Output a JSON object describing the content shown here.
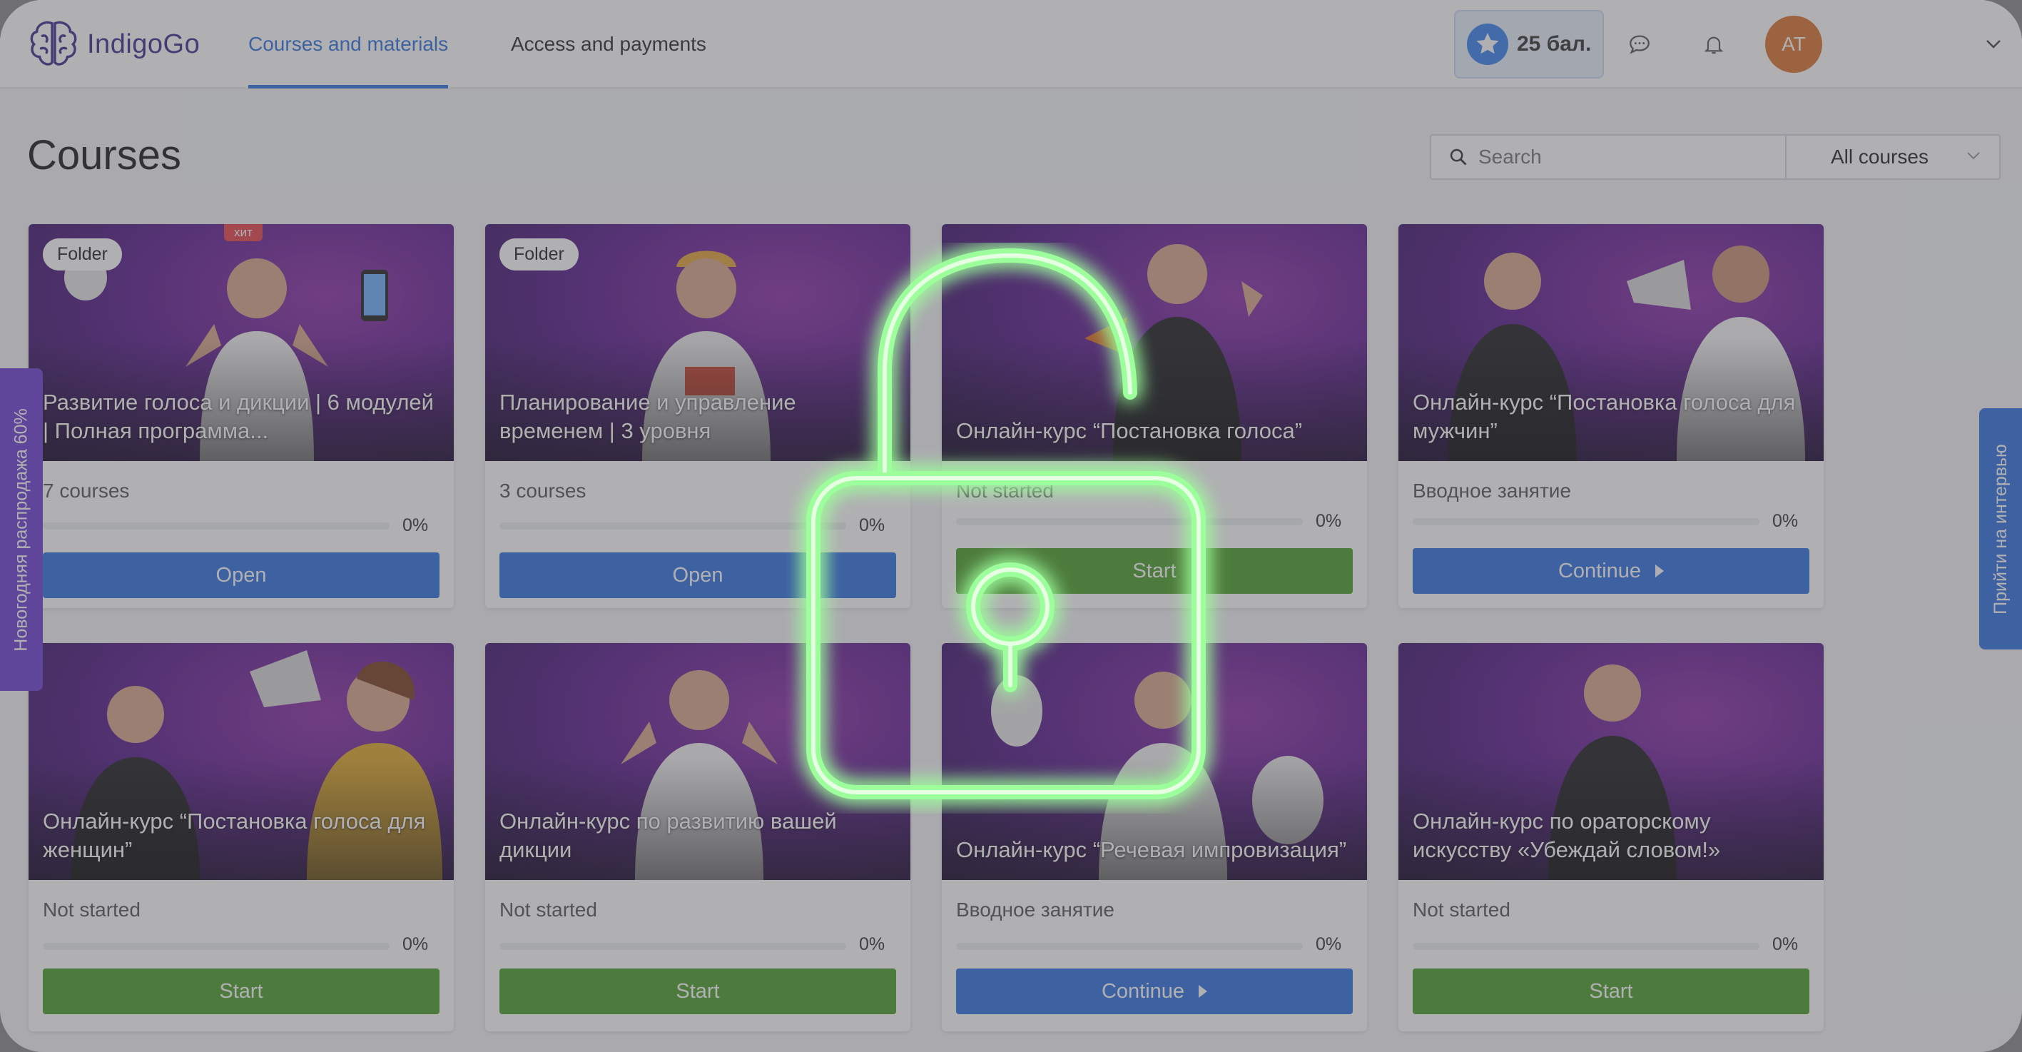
{
  "header": {
    "logo_text": "IndigoGo",
    "tabs": [
      {
        "label": "Courses and materials",
        "active": true
      },
      {
        "label": "Access and payments",
        "active": false
      }
    ],
    "points_label": "25 бал.",
    "avatar_initials": "AT"
  },
  "page": {
    "title": "Courses",
    "search_placeholder": "Search",
    "filter_value": "All courses"
  },
  "side_tabs": {
    "left": "Новогодняя распродажа 60%",
    "right": "Прийти на интервью"
  },
  "cards": [
    {
      "badge": "Folder",
      "hit": "хит",
      "title": "Развитие голоса и дикции | 6 модулей | Полная программа...",
      "status": "7 courses",
      "progress": "0%",
      "button": "Open",
      "button_color": "blue"
    },
    {
      "badge": "Folder",
      "title": "Планирование и управление временем | 3 уровня",
      "status": "3 courses",
      "progress": "0%",
      "button": "Open",
      "button_color": "blue"
    },
    {
      "title": "Онлайн-курс “Постановка голоса”",
      "status": "Not started",
      "progress": "0%",
      "button": "Start",
      "button_color": "green"
    },
    {
      "title": "Онлайн-курс “Постановка голоса для мужчин”",
      "status": "Вводное занятие",
      "progress": "0%",
      "button": "Continue",
      "button_color": "blue",
      "arrow": true
    },
    {
      "title": "Онлайн-курс “Постановка голоса для женщин”",
      "status": "Not started",
      "progress": "0%",
      "button": "Start",
      "button_color": "green"
    },
    {
      "title": "Онлайн-курс по развитию вашей дикции",
      "status": "Not started",
      "progress": "0%",
      "button": "Start",
      "button_color": "green"
    },
    {
      "title": "Онлайн-курс “Речевая импровизация”",
      "status": "Вводное занятие",
      "progress": "0%",
      "button": "Continue",
      "button_color": "blue",
      "arrow": true
    },
    {
      "title": "Онлайн-курс по ораторскому искусству «Убеждай словом!»",
      "status": "Not started",
      "progress": "0%",
      "button": "Start",
      "button_color": "green"
    }
  ],
  "colors": {
    "accent_blue": "#2f6fe0",
    "start_green": "#4b9e2b",
    "lock_glow": "#7dff8a",
    "side_left_purple": "#6c3fd6"
  },
  "icons": {
    "logo": "brain-icon",
    "points": "star-badge-icon",
    "chat": "chat-bubble-icon",
    "notifications": "bell-icon",
    "search": "search-icon",
    "overlay": "unlocked-padlock-icon"
  }
}
